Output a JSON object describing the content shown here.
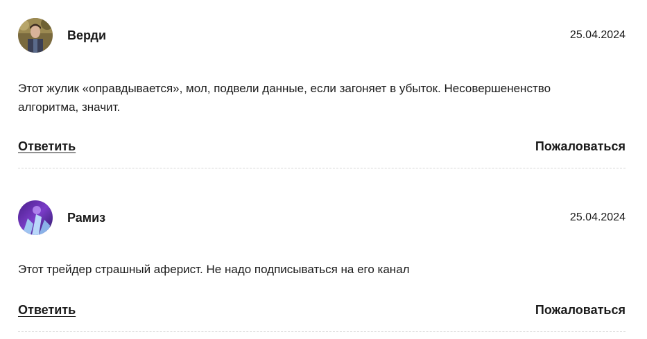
{
  "comments": [
    {
      "author": "Верди",
      "date": "25.04.2024",
      "text": "Этот жулик «оправдывается», мол, подвели данные, если загоняет в убыток. Несовершененство алгоритма, значит.",
      "reply_label": "Ответить",
      "report_label": "Пожаловаться"
    },
    {
      "author": "Рамиз",
      "date": "25.04.2024",
      "text": "Этот трейдер страшный аферист. Не надо подписываться на его канал",
      "reply_label": "Ответить",
      "report_label": "Пожаловаться"
    }
  ]
}
